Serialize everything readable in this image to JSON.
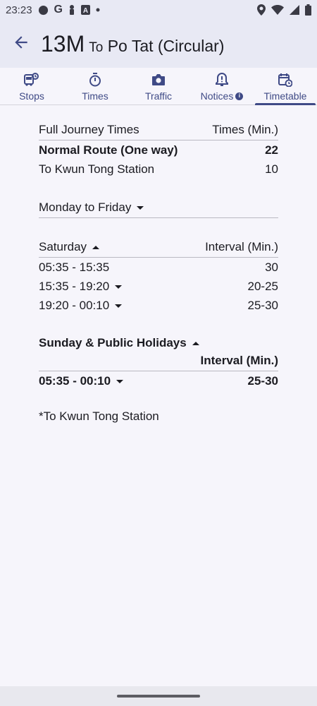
{
  "status_bar": {
    "time": "23:23",
    "left_icons": [
      "circle-notification-icon",
      "google-icon",
      "person-icon",
      "text-a-icon",
      "dot-icon"
    ],
    "right_icons": [
      "location-icon",
      "wifi-icon",
      "signal-icon",
      "battery-icon"
    ]
  },
  "app_bar": {
    "back_icon": "arrow-left-icon",
    "route_number": "13M",
    "route_to": "To",
    "route_destination": "Po Tat (Circular)"
  },
  "tabs": [
    {
      "label": "Stops",
      "icon": "bus-stop-icon",
      "active": false
    },
    {
      "label": "Times",
      "icon": "stopwatch-icon",
      "active": false
    },
    {
      "label": "Traffic",
      "icon": "camera-icon",
      "active": false
    },
    {
      "label": "Notices",
      "icon": "bell-alert-icon",
      "active": false,
      "badge": "info-icon"
    },
    {
      "label": "Timetable",
      "icon": "calendar-clock-icon",
      "active": true
    }
  ],
  "journey_times": {
    "header_label": "Full Journey Times",
    "header_value": "Times (Min.)",
    "rows": [
      {
        "label": "Normal Route (One way)",
        "value": "22",
        "bold": true
      },
      {
        "label": "To Kwun Tong Station",
        "value": "10",
        "bold": false
      }
    ]
  },
  "monday_friday": {
    "label": "Monday to Friday",
    "expanded": false
  },
  "saturday": {
    "label": "Saturday",
    "interval_header": "Interval (Min.)",
    "expanded": true,
    "rows": [
      {
        "period": "05:35 - 15:35",
        "interval": "30",
        "has_dropdown": false
      },
      {
        "period": "15:35 - 19:20",
        "interval": "20-25",
        "has_dropdown": true
      },
      {
        "period": "19:20 - 00:10",
        "interval": "25-30",
        "has_dropdown": true
      }
    ]
  },
  "sunday": {
    "label": "Sunday & Public Holidays",
    "interval_header": "Interval (Min.)",
    "expanded": true,
    "rows": [
      {
        "period": "05:35 - 00:10",
        "interval": "25-30",
        "has_dropdown": true
      }
    ]
  },
  "footnote": "*To Kwun Tong Station",
  "colors": {
    "accent": "#3f4a86",
    "app_bar_bg": "#e8e9f4",
    "page_bg": "#f6f5fb",
    "text": "#1b1b21"
  }
}
